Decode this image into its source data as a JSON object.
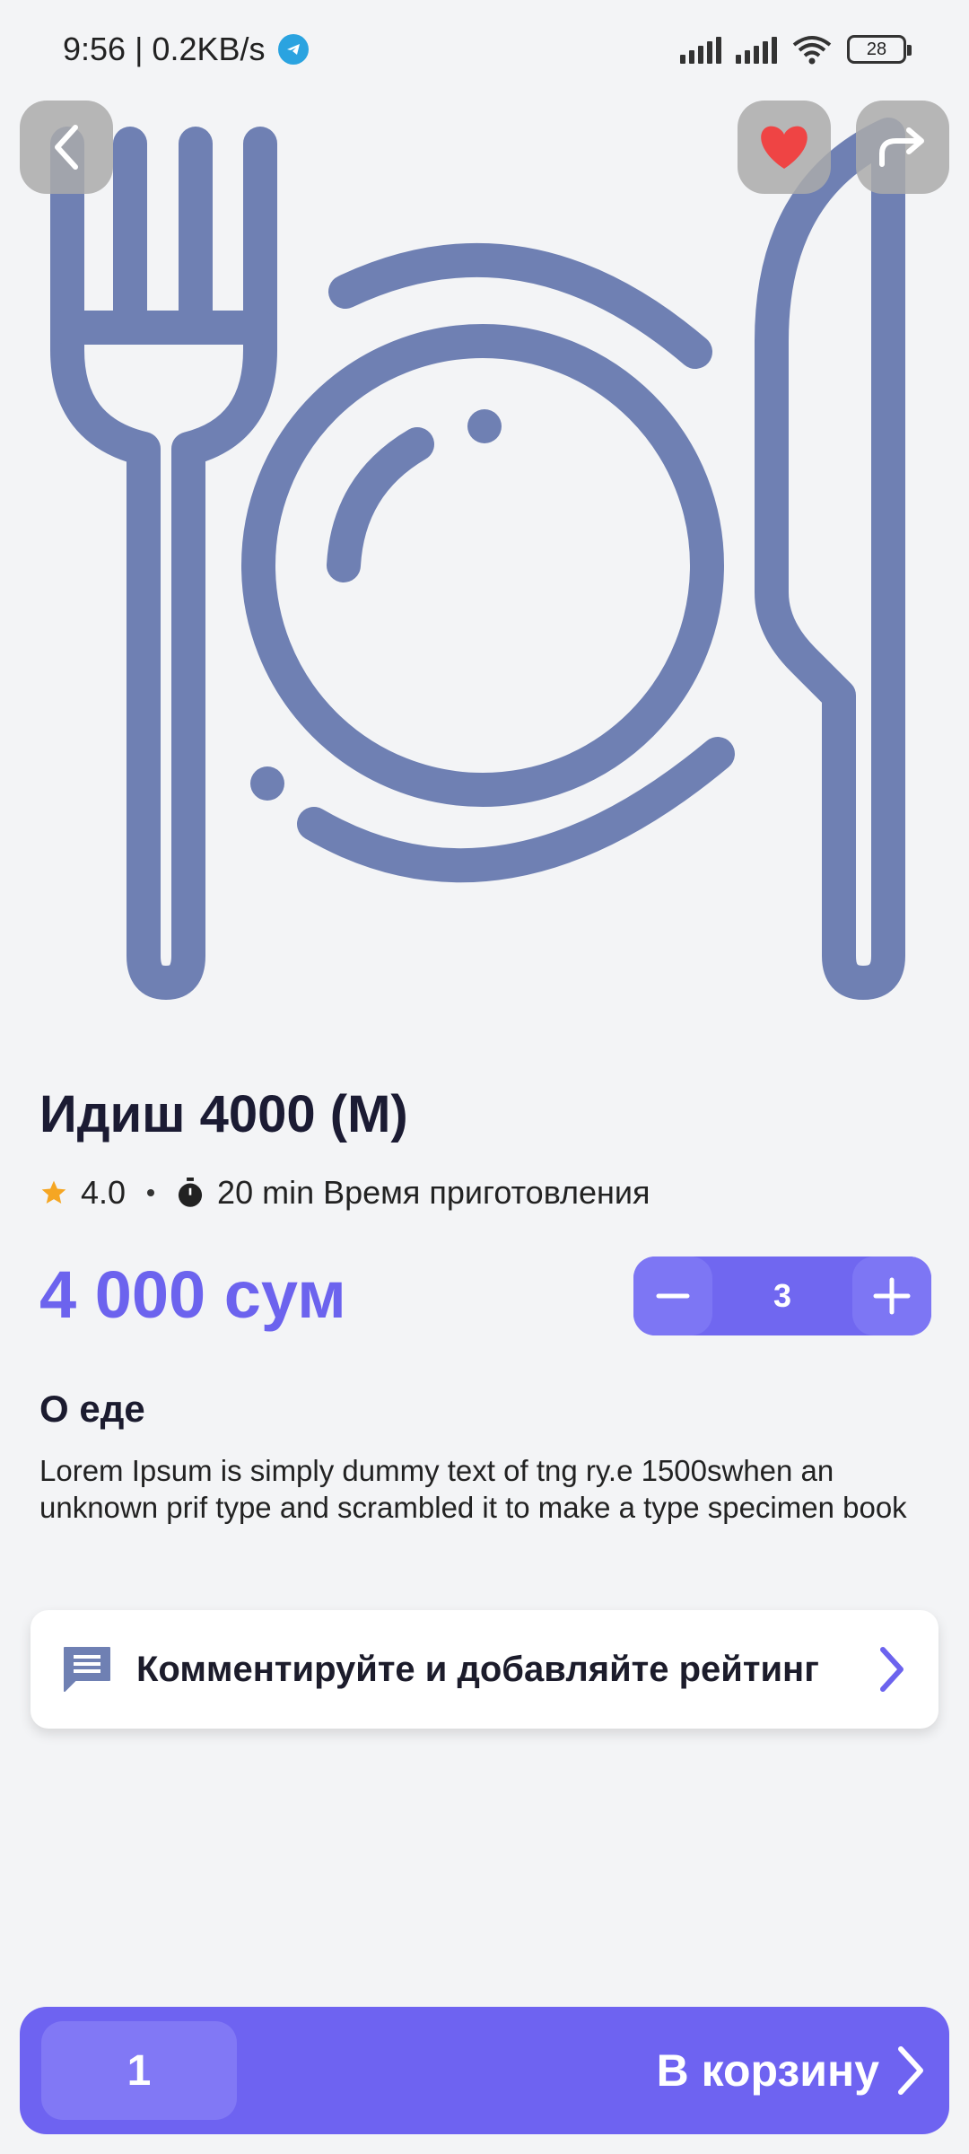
{
  "status_bar": {
    "time_speed": "9:56 | 0.2KB/s",
    "battery": "28"
  },
  "product": {
    "title": "Идиш 4000 (M)",
    "rating": "4.0",
    "prep_time": "20 min Время приготовления",
    "price": "4 000 сум",
    "quantity": "3"
  },
  "about": {
    "title": "О еде",
    "text": "Lorem Ipsum is simply dummy text of tng ry.e 1500swhen an unknown prif type and scrambled it to make a type specimen book"
  },
  "comment": {
    "label": "Комментируйте и добавляйте рейтинг"
  },
  "cart": {
    "count": "1",
    "label": "В корзину"
  },
  "colors": {
    "accent": "#6c63ee",
    "illustration": "#6f80b3",
    "favorite": "#ef4444",
    "star": "#f5a623"
  }
}
